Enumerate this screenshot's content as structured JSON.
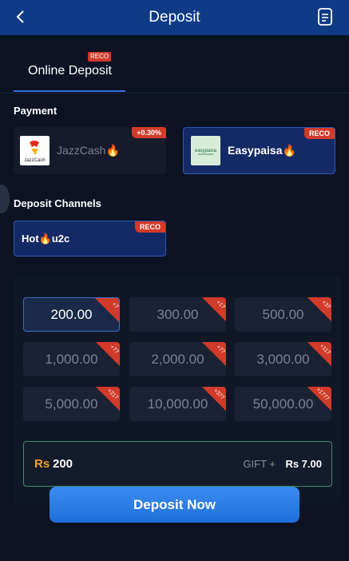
{
  "header": {
    "title": "Deposit",
    "back_icon": "chevron-left-icon",
    "doc_icon": "document-icon"
  },
  "tabs": [
    {
      "label": "Online Deposit",
      "badge": "RECO"
    }
  ],
  "payment": {
    "title": "Payment",
    "methods": [
      {
        "name": "JazzCash",
        "emoji": "🔥",
        "badge": "+0.30%",
        "logo_text": "JazzCash"
      },
      {
        "name": "Easypaisa",
        "emoji": "🔥",
        "badge": "RECO",
        "logo_text": "easypaisa"
      }
    ]
  },
  "channels": {
    "title": "Deposit Channels",
    "items": [
      {
        "name_pre": "Hot",
        "emoji": "🔥",
        "name_post": "u2c",
        "badge": "RECO"
      }
    ]
  },
  "amounts": [
    {
      "value": "200.00",
      "tag": "+7",
      "selected": true
    },
    {
      "value": "300.00",
      "tag": "+17",
      "selected": false
    },
    {
      "value": "500.00",
      "tag": "+37",
      "selected": false
    },
    {
      "value": "1,000.00",
      "tag": "+77",
      "selected": false
    },
    {
      "value": "2,000.00",
      "tag": "+77",
      "selected": false
    },
    {
      "value": "3,000.00",
      "tag": "+117",
      "selected": false
    },
    {
      "value": "5,000.00",
      "tag": "+217",
      "selected": false
    },
    {
      "value": "10,000.00",
      "tag": "+377",
      "selected": false
    },
    {
      "value": "50,000.00",
      "tag": "+1777",
      "selected": false
    }
  ],
  "summary": {
    "currency": "Rs",
    "amount": "200",
    "gift_label": "GIFT +",
    "gift_value": "Rs 7.00"
  },
  "cta": {
    "label": "Deposit Now"
  },
  "colors": {
    "header": "#0f3a86",
    "accent": "#2f6fe0",
    "badge": "#d23a2a",
    "currency": "#f0a030"
  }
}
